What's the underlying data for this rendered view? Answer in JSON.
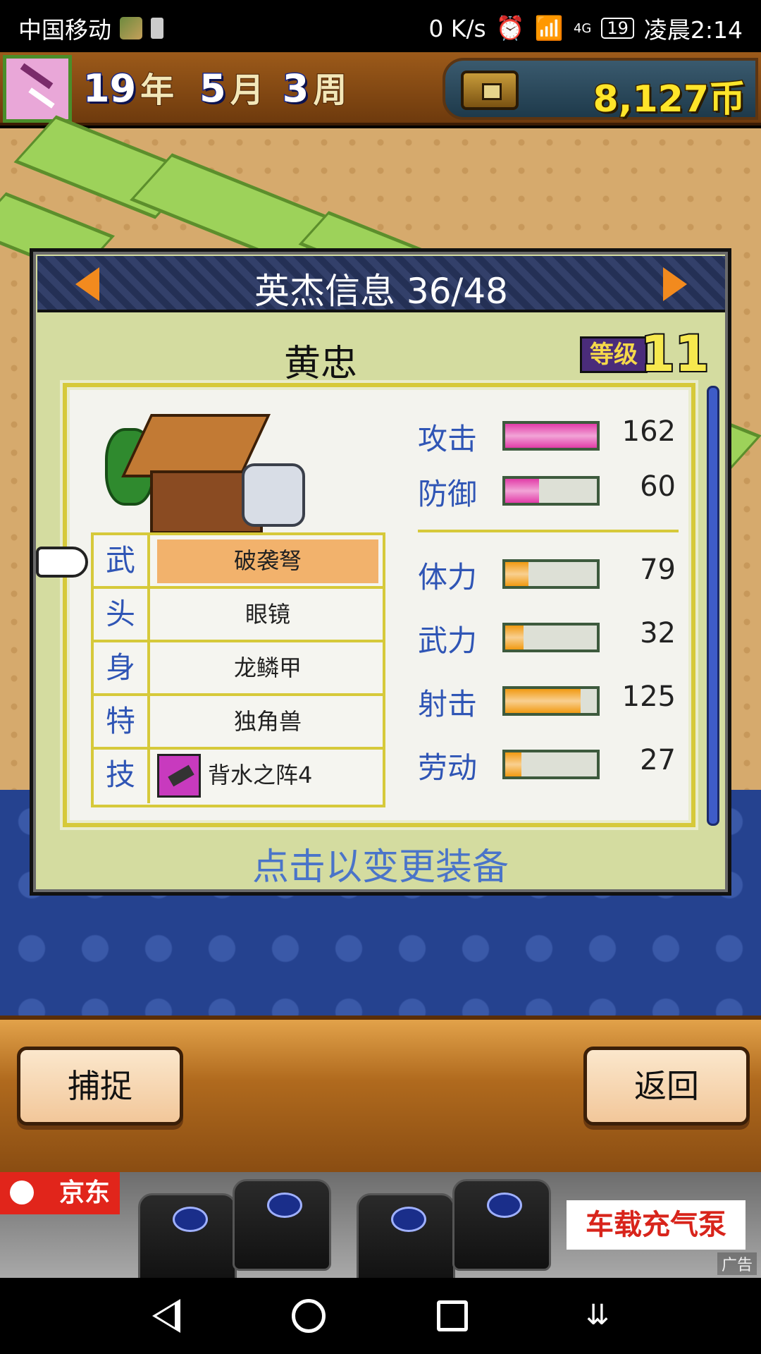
{
  "status_bar": {
    "carrier": "中国移动",
    "speed": "0 K/s",
    "network": "4G",
    "battery": "19",
    "time": "凌晨2:14"
  },
  "hud": {
    "year": "19",
    "year_unit": "年",
    "month": "5",
    "month_unit": "月",
    "week": "3",
    "week_unit": "周",
    "money": "8,127币"
  },
  "dialog": {
    "title": "英杰信息 36/48",
    "hero_name": "黄忠",
    "level_label": "等级",
    "level": "11",
    "hint": "点击以变更装备"
  },
  "equipment": [
    {
      "slot": "武",
      "item": "破袭弩",
      "selected": true
    },
    {
      "slot": "头",
      "item": "眼镜"
    },
    {
      "slot": "身",
      "item": "龙鳞甲"
    },
    {
      "slot": "特",
      "item": "独角兽"
    },
    {
      "slot": "技",
      "item": "背水之阵4"
    }
  ],
  "stats": [
    {
      "label": "攻击",
      "value": "162",
      "fill": 1.0,
      "color": "#e23ca8"
    },
    {
      "label": "防御",
      "value": "60",
      "fill": 0.37,
      "color": "#e23ca8"
    },
    {
      "label": "体力",
      "value": "79",
      "fill": 0.25,
      "color": "#f19a12"
    },
    {
      "label": "武力",
      "value": "32",
      "fill": 0.2,
      "color": "#f19a12"
    },
    {
      "label": "射击",
      "value": "125",
      "fill": 0.82,
      "color": "#f19a12"
    },
    {
      "label": "劳动",
      "value": "27",
      "fill": 0.18,
      "color": "#f19a12"
    }
  ],
  "buttons": {
    "capture": "捕捉",
    "back": "返回"
  },
  "ad": {
    "brand": "京东",
    "headline": "车载充气泵",
    "tag": "广告"
  }
}
